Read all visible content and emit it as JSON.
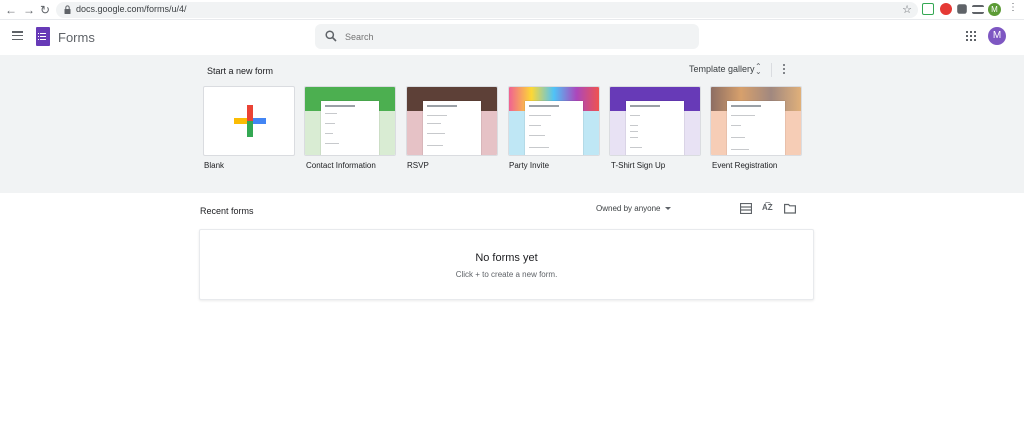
{
  "browser": {
    "url": "docs.google.com/forms/u/4/",
    "avatar_letter": "M"
  },
  "header": {
    "app_name": "Forms",
    "search_placeholder": "Search",
    "avatar_letter": "M",
    "brand_color": "#673ab7"
  },
  "templates": {
    "section_title": "Start a new form",
    "gallery_label": "Template gallery",
    "items": [
      {
        "label": "Blank"
      },
      {
        "label": "Contact Information",
        "accent": "#4caf50"
      },
      {
        "label": "RSVP",
        "accent": "#e6a8b0"
      },
      {
        "label": "Party Invite",
        "accent": "#a6e3f5"
      },
      {
        "label": "T-Shirt Sign Up",
        "accent": "#673ab7"
      },
      {
        "label": "Event Registration",
        "accent": "#f6c9ae"
      }
    ]
  },
  "recent": {
    "title": "Recent forms",
    "owner_filter": "Owned by anyone",
    "empty_title": "No forms yet",
    "empty_subtitle": "Click + to create a new form."
  }
}
